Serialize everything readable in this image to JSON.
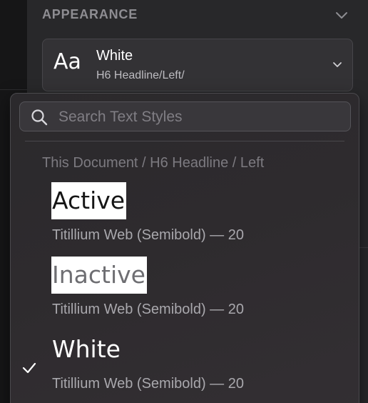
{
  "section": {
    "title": "APPEARANCE",
    "collapse_icon": "chevron-down-icon"
  },
  "style_select": {
    "glyph": "Aa",
    "name": "White",
    "path": "H6 Headline/Left/",
    "chevron_icon": "chevron-down-icon"
  },
  "popover": {
    "search_placeholder": "Search Text Styles",
    "search_value": "",
    "group_label": "This Document / H6 Headline / Left",
    "items": [
      {
        "name": "Active",
        "meta": "Titillium Web (Semibold) — 20",
        "preview_color": "#151515",
        "preview_background": "#ffffff",
        "selected": false
      },
      {
        "name": "Inactive",
        "meta": "Titillium Web (Semibold) — 20",
        "preview_color": "#6e6e72",
        "preview_background": "#ffffff",
        "selected": false
      },
      {
        "name": "White",
        "meta": "Titillium Web (Semibold) — 20",
        "preview_color": "#ffffff",
        "preview_background": "none",
        "selected": true
      }
    ]
  },
  "colors": {
    "panel": "#28282a",
    "popover": "#2e2b2e",
    "muted_text": "#7c7a80"
  }
}
